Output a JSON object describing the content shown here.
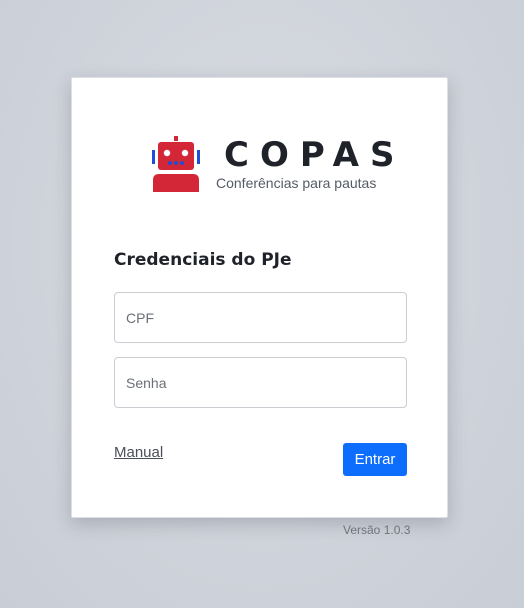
{
  "brand": {
    "name": "COPAS",
    "subtitle": "Conferências para pautas",
    "logo_icon": "robot-icon",
    "logo_colors": {
      "primary": "#d32738",
      "accent": "#1f4ed8"
    }
  },
  "form": {
    "title": "Credenciais do PJe",
    "cpf": {
      "placeholder": "CPF",
      "value": ""
    },
    "senha": {
      "placeholder": "Senha",
      "value": ""
    },
    "manual_label": "Manual",
    "submit_label": "Entrar"
  },
  "footer": {
    "version": "Versão 1.0.3"
  },
  "colors": {
    "button": "#0d6efd",
    "background": "#cfd3db"
  }
}
